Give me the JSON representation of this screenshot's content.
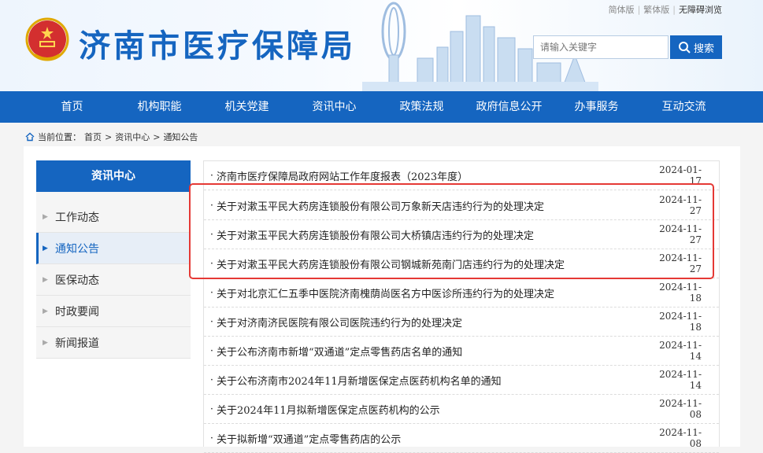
{
  "header": {
    "site_title": "济南市医疗保障局",
    "top_links": [
      "简体版",
      "繁体版",
      "无障碍浏览"
    ],
    "search": {
      "placeholder": "请输入关键字",
      "button_label": "搜索"
    }
  },
  "nav": {
    "items": [
      "首页",
      "机构职能",
      "机关党建",
      "资讯中心",
      "政策法规",
      "政府信息公开",
      "办事服务",
      "互动交流"
    ]
  },
  "breadcrumb": {
    "prefix": "当前位置：",
    "home": "首页",
    "sep1": ">",
    "level1": "资讯中心",
    "sep2": ">",
    "level2": "通知公告"
  },
  "sidebar": {
    "header": "资讯中心",
    "items": [
      {
        "label": "工作动态",
        "active": false
      },
      {
        "label": "通知公告",
        "active": true
      },
      {
        "label": "医保动态",
        "active": false
      },
      {
        "label": "时政要闻",
        "active": false
      },
      {
        "label": "新闻报道",
        "active": false
      }
    ]
  },
  "articles": [
    {
      "title": "济南市医疗保障局政府网站工作年度报表（2023年度）",
      "date": "2024-01-17"
    },
    {
      "title": "关于对漱玉平民大药房连锁股份有限公司万象新天店违约行为的处理决定",
      "date": "2024-11-27"
    },
    {
      "title": "关于对漱玉平民大药房连锁股份有限公司大桥镇店违约行为的处理决定",
      "date": "2024-11-27"
    },
    {
      "title": "关于对漱玉平民大药房连锁股份有限公司钢城新苑南门店违约行为的处理决定",
      "date": "2024-11-27"
    },
    {
      "title": "关于对北京汇仁五季中医院济南槐荫尚医名方中医诊所违约行为的处理决定",
      "date": "2024-11-18"
    },
    {
      "title": "关于对济南济民医院有限公司医院违约行为的处理决定",
      "date": "2024-11-18"
    },
    {
      "title": "关于公布济南市新增“双通道”定点零售药店名单的通知",
      "date": "2024-11-14"
    },
    {
      "title": "关于公布济南市2024年11月新增医保定点医药机构名单的通知",
      "date": "2024-11-14"
    },
    {
      "title": "关于2024年11月拟新增医保定点医药机构的公示",
      "date": "2024-11-08"
    },
    {
      "title": "关于拟新增“双通道”定点零售药店的公示",
      "date": "2024-11-08"
    }
  ],
  "colors": {
    "brand_blue": "#1565c0",
    "highlight_red": "#e53935"
  },
  "icons": [
    "national-emblem-icon",
    "search-icon",
    "home-icon",
    "arrow-right-icon"
  ]
}
